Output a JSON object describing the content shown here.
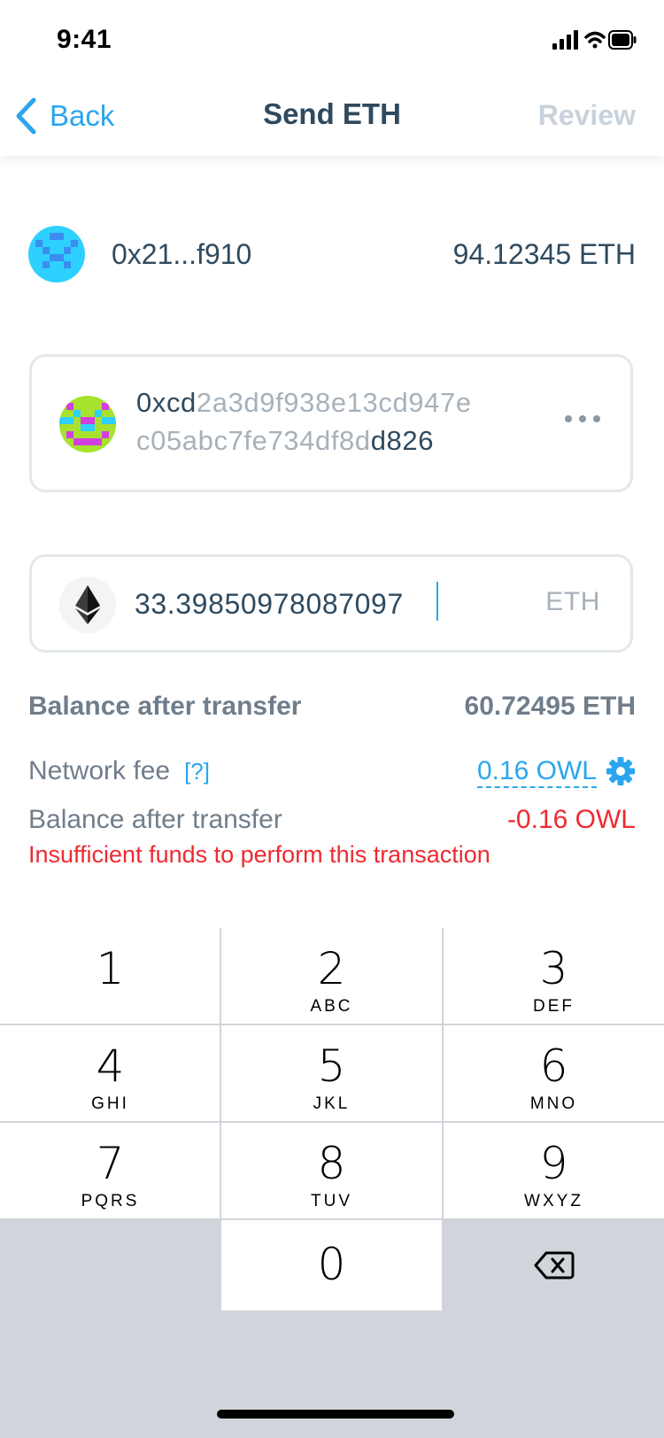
{
  "status_bar": {
    "time": "9:41"
  },
  "nav": {
    "back_label": "Back",
    "title": "Send ETH",
    "review_label": "Review"
  },
  "account": {
    "address": "0x21...f910",
    "balance": "94.12345 ETH"
  },
  "recipient": {
    "address_prefix": "0xcd",
    "address_middle_1": "2a3d9f938e13cd947e",
    "address_middle_2": "c05abc7fe734df8d",
    "address_suffix": "d826"
  },
  "amount": {
    "value": "33.39850978087097",
    "currency": "ETH"
  },
  "summary": {
    "balance_after_label": "Balance after transfer",
    "balance_after_value": "60.72495 ETH",
    "network_fee_label": "Network fee",
    "help_link": "[?]",
    "network_fee_value": "0.16 OWL",
    "fee_balance_label": "Balance after transfer",
    "fee_balance_value": "-0.16 OWL",
    "error": "Insufficient funds to perform this transaction"
  },
  "keypad": {
    "keys": [
      {
        "digit": "1",
        "letters": ""
      },
      {
        "digit": "2",
        "letters": "ABC"
      },
      {
        "digit": "3",
        "letters": "DEF"
      },
      {
        "digit": "4",
        "letters": "GHI"
      },
      {
        "digit": "5",
        "letters": "JKL"
      },
      {
        "digit": "6",
        "letters": "MNO"
      },
      {
        "digit": "7",
        "letters": "PQRS"
      },
      {
        "digit": "8",
        "letters": "TUV"
      },
      {
        "digit": "9",
        "letters": "WXYZ"
      },
      {
        "digit": "0",
        "letters": ""
      }
    ],
    "delete_icon": "backspace-icon"
  },
  "colors": {
    "accent": "#2aa6ee",
    "text": "#2f4a5f",
    "muted": "#a7b1bb",
    "error": "#ee2a31"
  }
}
